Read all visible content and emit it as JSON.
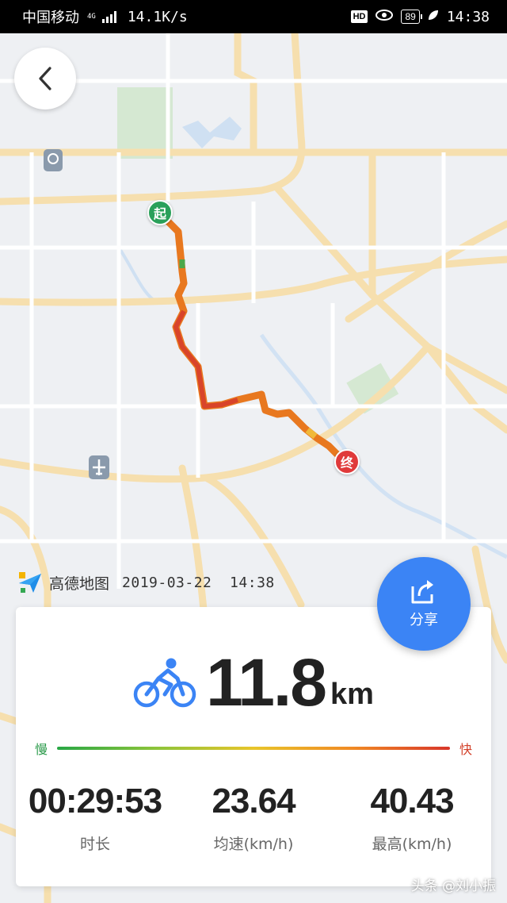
{
  "status_bar": {
    "carrier": "中国移动",
    "network": "4G",
    "speed": "14.1K/s",
    "hd": "HD",
    "battery": "89",
    "time": "14:38"
  },
  "map": {
    "start_label": "起",
    "end_label": "终",
    "brand": "高德地图",
    "timestamp": "2019-03-22  14:38",
    "share_label": "分享"
  },
  "summary": {
    "distance": "11.8",
    "distance_unit": "km",
    "slow_label": "慢",
    "fast_label": "快",
    "stats": [
      {
        "value": "00:29:53",
        "label": "时长"
      },
      {
        "value": "23.64",
        "label": "均速(km/h)"
      },
      {
        "value": "40.43",
        "label": "最高(km/h)"
      }
    ]
  },
  "watermark": "头条 @刘小振",
  "colors": {
    "accent": "#3b84f5",
    "start": "#2aa05a",
    "end": "#e03a3a",
    "route": "#e8781f"
  }
}
